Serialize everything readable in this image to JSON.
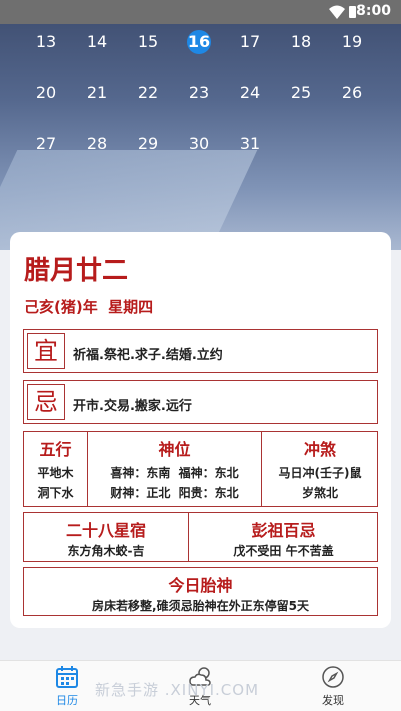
{
  "status": {
    "time": "8:00"
  },
  "calendar": {
    "rows": [
      [
        "13",
        "14",
        "15",
        "16",
        "17",
        "18",
        "19"
      ],
      [
        "20",
        "21",
        "22",
        "23",
        "24",
        "25",
        "26"
      ],
      [
        "27",
        "28",
        "29",
        "30",
        "31"
      ]
    ],
    "today": "16"
  },
  "almanac": {
    "lunar_date": "腊月廿二",
    "ganzhi": "己亥(猪)年  星期四",
    "yi_glyph": "宜",
    "yi_text": "祈福.祭祀.求子.结婚.立约",
    "ji_glyph": "忌",
    "ji_text": "开市.交易.搬家.远行",
    "wuxing": {
      "title": "五行",
      "lines": [
        "平地木",
        "洞下水"
      ]
    },
    "shenwei": {
      "title": "神位",
      "lines": [
        "喜神：东南  福神：东北",
        "财神：正北  阳贵：东北"
      ]
    },
    "chongsha": {
      "title": "冲煞",
      "lines": [
        "马日冲(壬子)鼠",
        "岁煞北"
      ]
    },
    "xingsu": {
      "title": "二十八星宿",
      "text": "东方角木蛟-吉"
    },
    "pengzu": {
      "title": "彭祖百忌",
      "text": "戊不受田 午不苦盖"
    },
    "taishen": {
      "title": "今日胎神",
      "text": "房床若移整,碓须忌胎神在外正东停留5天"
    }
  },
  "tabs": [
    {
      "label": "日历",
      "icon": "calendar-icon",
      "active": true
    },
    {
      "label": "天气",
      "icon": "weather-icon",
      "active": false
    },
    {
      "label": "发现",
      "icon": "compass-icon",
      "active": false
    }
  ],
  "watermark": "新急手游 .XINYI.COM",
  "colors": {
    "accent": "#b71c1c",
    "tab_active": "#1e88e5",
    "today": "#1e88e5"
  }
}
